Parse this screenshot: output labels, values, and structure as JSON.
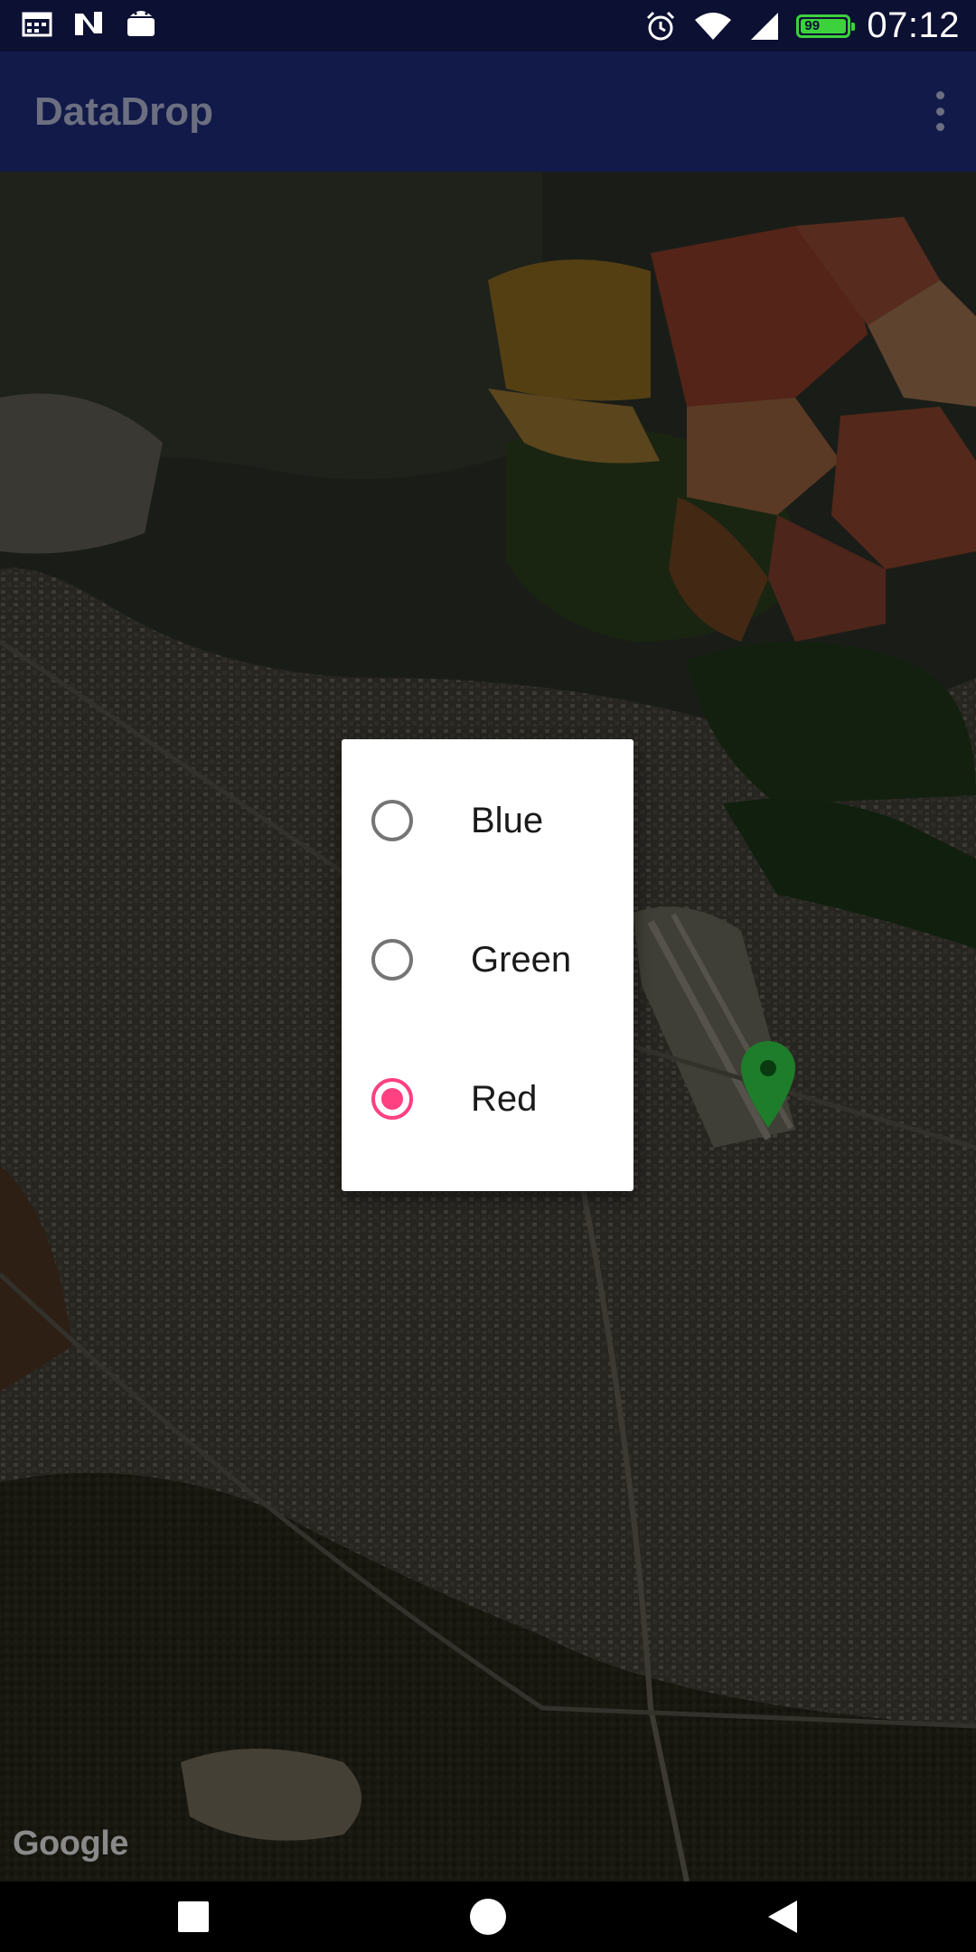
{
  "status_bar": {
    "time": "07:12",
    "battery_level": "99",
    "battery_fraction": 0.99,
    "battery_color": "#3cd23c",
    "left_icons": [
      "calendar-icon",
      "n-notification-icon",
      "android-icon"
    ],
    "right_icons": [
      "alarm-icon",
      "wifi-icon",
      "cellular-signal-icon",
      "battery-icon"
    ]
  },
  "app_bar": {
    "title": "DataDrop",
    "menu_icon": "more-vert-icon"
  },
  "map": {
    "attribution": "Google",
    "marker_color": "#1e7d2a",
    "marker_icon": "map-pin-icon"
  },
  "dialog": {
    "accent_color": "#ff4081",
    "options": [
      {
        "label": "Blue",
        "checked": false
      },
      {
        "label": "Green",
        "checked": false
      },
      {
        "label": "Red",
        "checked": true
      }
    ]
  },
  "nav_bar": {
    "buttons": [
      "recents-square-icon",
      "home-circle-icon",
      "back-triangle-icon"
    ]
  }
}
